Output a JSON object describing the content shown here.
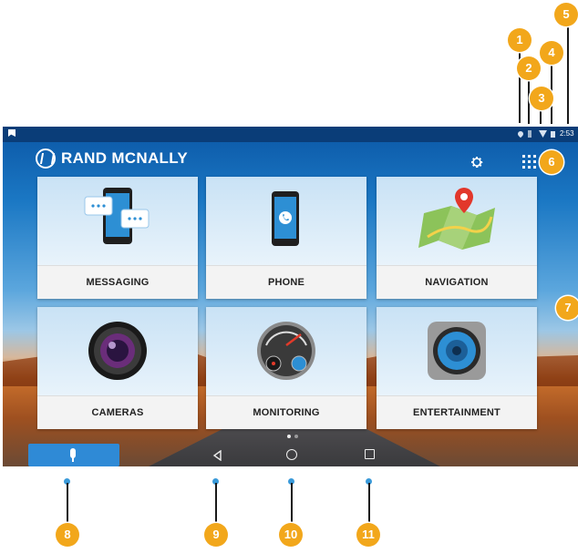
{
  "status_bar": {
    "time": "2:53"
  },
  "header": {
    "logo_text": "RAND MCNALLY"
  },
  "tiles": [
    {
      "label": "MESSAGING"
    },
    {
      "label": "PHONE"
    },
    {
      "label": "NAVIGATION"
    },
    {
      "label": "CAMERAS"
    },
    {
      "label": "MONITORING"
    },
    {
      "label": "ENTERTAINMENT"
    }
  ],
  "callouts": [
    "1",
    "2",
    "3",
    "4",
    "5",
    "6",
    "7",
    "8",
    "9",
    "10",
    "11"
  ],
  "icons": {
    "status": [
      "location-icon",
      "bluetooth-icon",
      "wifi-icon",
      "battery-icon"
    ],
    "header": [
      "settings-gear-icon",
      "apps-grid-icon"
    ],
    "nav": [
      "microphone-icon",
      "back-icon",
      "home-icon",
      "recents-icon"
    ]
  },
  "colors": {
    "callout": "#f2a71b",
    "status_bar": "#0a3d78",
    "mic_button": "#2f8ad6"
  }
}
